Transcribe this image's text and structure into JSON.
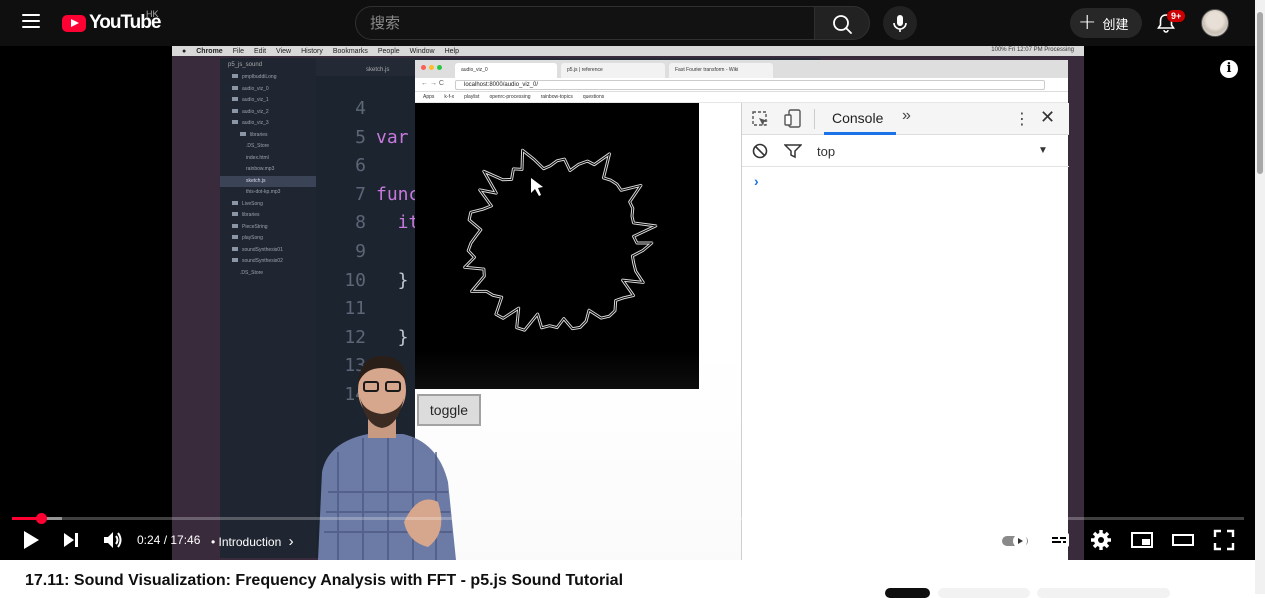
{
  "header": {
    "logo_text": "YouTube",
    "region": "HK",
    "search_placeholder": "搜索",
    "create_label": "创建",
    "notifications_badge": "9+"
  },
  "video_content": {
    "mac_menu": [
      "Chrome",
      "File",
      "Edit",
      "View",
      "History",
      "Bookmarks",
      "People",
      "Window",
      "Help"
    ],
    "mac_status": "100%  Fri 12:07 PM   Processing",
    "editor_tab": "sketch.js",
    "file_tree_root": "p5_js_sound",
    "file_tree": [
      "pmpIbuddiLong",
      "audio_viz_0",
      "audio_viz_1",
      "audio_viz_2",
      "audio_viz_3",
      "libraries",
      ".DS_Store",
      "index.html",
      "rainbow.mp3",
      "sketch.js",
      "this-dot-kp.mp3",
      "LiveSong",
      "libraries",
      "PieceString",
      "playSong",
      "soundSynthesis01",
      "soundSynthesis02",
      ".DS_Store"
    ],
    "line_numbers": [
      "4",
      "5",
      "6",
      "7",
      "8",
      "9",
      "10",
      "11",
      "12",
      "13",
      "14"
    ],
    "code_lines": [
      "",
      "var",
      "",
      "func",
      "  it",
      "",
      "  }",
      "",
      "  }",
      "",
      ""
    ],
    "browser_tabs": [
      "audio_viz_0",
      "p5.js | reference",
      "Fast Fourier transform - Wiki"
    ],
    "url": "localhost:8000/audio_viz_0/",
    "bookmarks": [
      "Apps",
      "k-f-x",
      "playlist",
      "openrc-processing",
      "rainbow-topics",
      "questions"
    ],
    "toggle_label": "toggle",
    "devtools_tab": "Console",
    "devtools_context": "top",
    "console_prompt": "›"
  },
  "player": {
    "time": "0:24 / 17:46",
    "chapter": "• Introduction",
    "chapter_arrow": "›",
    "progress_played_fraction": 0.0234,
    "progress_loaded_fraction": 0.0406
  },
  "title": "17.11: Sound Visualization: Frequency Analysis with FFT - p5.js Sound Tutorial",
  "colors": {
    "brand_red": "#ff0033",
    "masthead_bg": "#0f0f0f",
    "devtools_accent": "#1a73e8"
  }
}
